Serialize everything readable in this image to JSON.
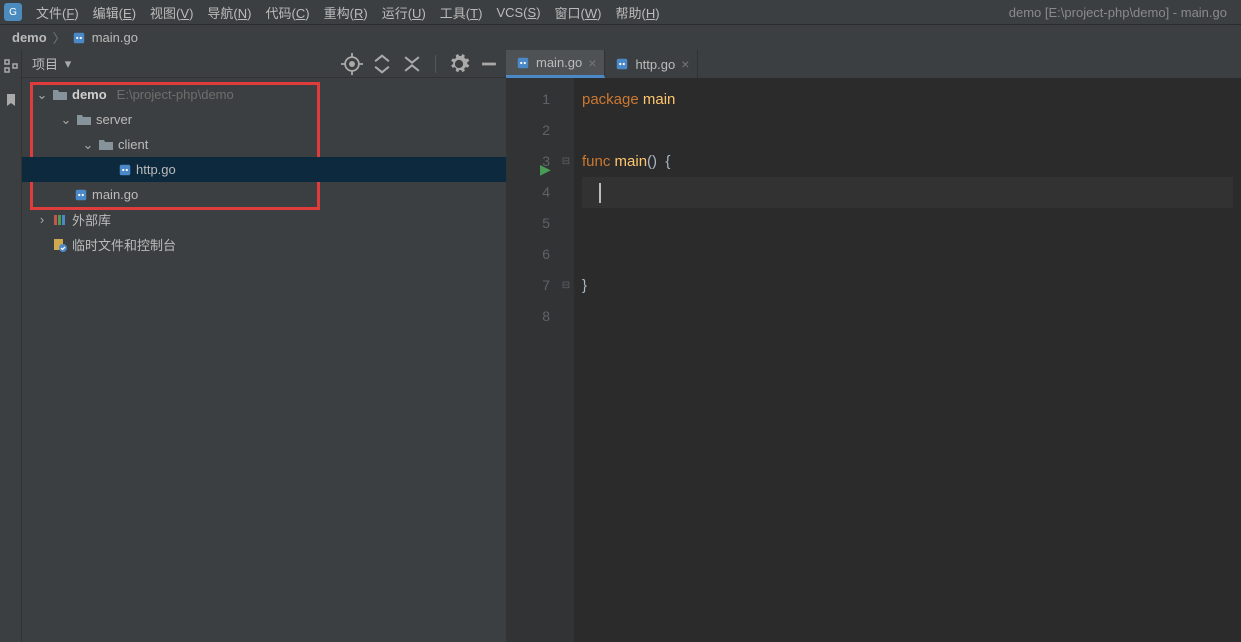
{
  "window": {
    "title_path": "demo [E:\\project-php\\demo] - main.go"
  },
  "menubar": {
    "items": [
      {
        "label": "文件",
        "key": "F"
      },
      {
        "label": "编辑",
        "key": "E"
      },
      {
        "label": "视图",
        "key": "V"
      },
      {
        "label": "导航",
        "key": "N"
      },
      {
        "label": "代码",
        "key": "C"
      },
      {
        "label": "重构",
        "key": "R"
      },
      {
        "label": "运行",
        "key": "U"
      },
      {
        "label": "工具",
        "key": "T"
      },
      {
        "label": "VCS",
        "key": "S"
      },
      {
        "label": "窗口",
        "key": "W"
      },
      {
        "label": "帮助",
        "key": "H"
      }
    ]
  },
  "breadcrumb": {
    "project": "demo",
    "file": "main.go"
  },
  "sidebar": {
    "header": {
      "project_label": "项目"
    },
    "tree": {
      "root": {
        "name": "demo",
        "path": "E:\\project-php\\demo"
      },
      "server": "server",
      "client": "client",
      "httpgo": "http.go",
      "maingo": "main.go",
      "external_libs": "外部库",
      "scratches": "临时文件和控制台"
    }
  },
  "editor": {
    "tabs": [
      {
        "name": "main.go",
        "active": true
      },
      {
        "name": "http.go",
        "active": false
      }
    ],
    "line_numbers": [
      "1",
      "2",
      "3",
      "4",
      "5",
      "6",
      "7",
      "8"
    ],
    "code": {
      "l1_kw": "package",
      "l1_sp": " ",
      "l1_id": "main",
      "l3_kw": "func",
      "l3_sp": " ",
      "l3_id": "main",
      "l3_par": "()  {",
      "l7": "}"
    }
  }
}
